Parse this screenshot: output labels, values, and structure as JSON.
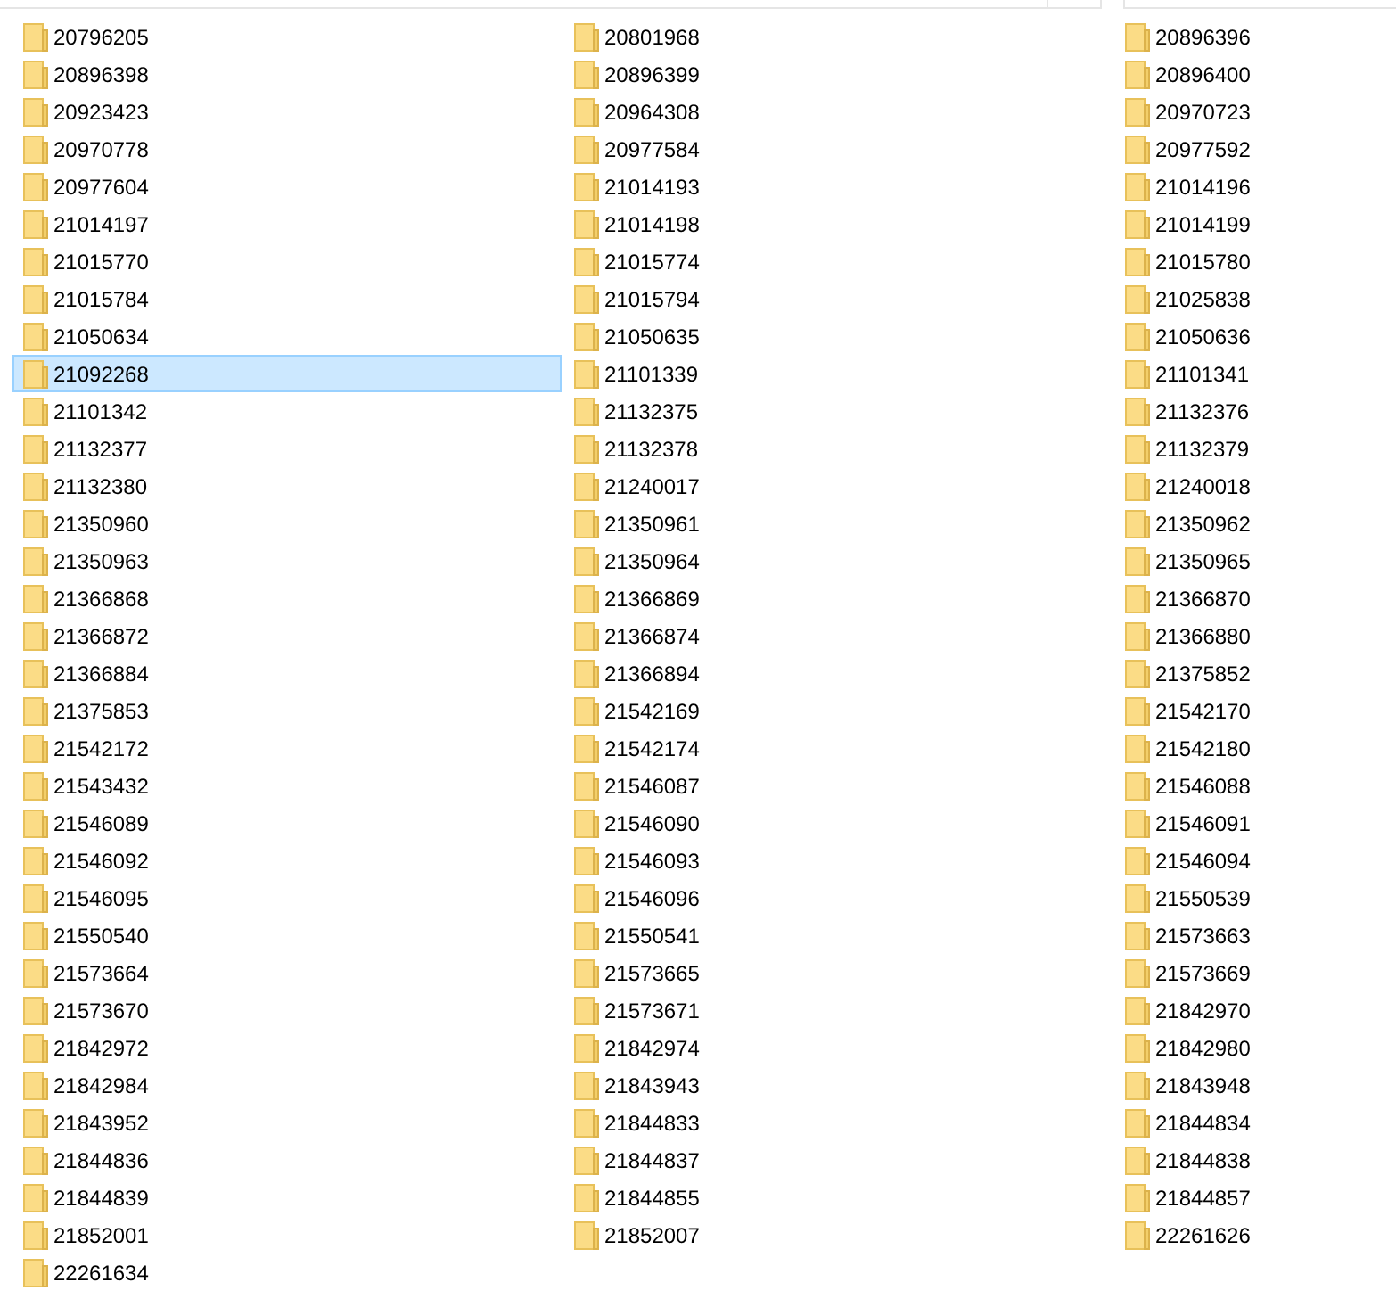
{
  "columns": [
    {
      "items": [
        {
          "name": "20796205",
          "selected": false
        },
        {
          "name": "20896398",
          "selected": false
        },
        {
          "name": "20923423",
          "selected": false
        },
        {
          "name": "20970778",
          "selected": false
        },
        {
          "name": "20977604",
          "selected": false
        },
        {
          "name": "21014197",
          "selected": false
        },
        {
          "name": "21015770",
          "selected": false
        },
        {
          "name": "21015784",
          "selected": false
        },
        {
          "name": "21050634",
          "selected": false
        },
        {
          "name": "21092268",
          "selected": true
        },
        {
          "name": "21101342",
          "selected": false
        },
        {
          "name": "21132377",
          "selected": false
        },
        {
          "name": "21132380",
          "selected": false
        },
        {
          "name": "21350960",
          "selected": false
        },
        {
          "name": "21350963",
          "selected": false
        },
        {
          "name": "21366868",
          "selected": false
        },
        {
          "name": "21366872",
          "selected": false
        },
        {
          "name": "21366884",
          "selected": false
        },
        {
          "name": "21375853",
          "selected": false
        },
        {
          "name": "21542172",
          "selected": false
        },
        {
          "name": "21543432",
          "selected": false
        },
        {
          "name": "21546089",
          "selected": false
        },
        {
          "name": "21546092",
          "selected": false
        },
        {
          "name": "21546095",
          "selected": false
        },
        {
          "name": "21550540",
          "selected": false
        },
        {
          "name": "21573664",
          "selected": false
        },
        {
          "name": "21573670",
          "selected": false
        },
        {
          "name": "21842972",
          "selected": false
        },
        {
          "name": "21842984",
          "selected": false
        },
        {
          "name": "21843952",
          "selected": false
        },
        {
          "name": "21844836",
          "selected": false
        },
        {
          "name": "21844839",
          "selected": false
        },
        {
          "name": "21852001",
          "selected": false
        },
        {
          "name": "22261634",
          "selected": false
        }
      ]
    },
    {
      "items": [
        {
          "name": "20801968",
          "selected": false
        },
        {
          "name": "20896399",
          "selected": false
        },
        {
          "name": "20964308",
          "selected": false
        },
        {
          "name": "20977584",
          "selected": false
        },
        {
          "name": "21014193",
          "selected": false
        },
        {
          "name": "21014198",
          "selected": false
        },
        {
          "name": "21015774",
          "selected": false
        },
        {
          "name": "21015794",
          "selected": false
        },
        {
          "name": "21050635",
          "selected": false
        },
        {
          "name": "21101339",
          "selected": false
        },
        {
          "name": "21132375",
          "selected": false
        },
        {
          "name": "21132378",
          "selected": false
        },
        {
          "name": "21240017",
          "selected": false
        },
        {
          "name": "21350961",
          "selected": false
        },
        {
          "name": "21350964",
          "selected": false
        },
        {
          "name": "21366869",
          "selected": false
        },
        {
          "name": "21366874",
          "selected": false
        },
        {
          "name": "21366894",
          "selected": false
        },
        {
          "name": "21542169",
          "selected": false
        },
        {
          "name": "21542174",
          "selected": false
        },
        {
          "name": "21546087",
          "selected": false
        },
        {
          "name": "21546090",
          "selected": false
        },
        {
          "name": "21546093",
          "selected": false
        },
        {
          "name": "21546096",
          "selected": false
        },
        {
          "name": "21550541",
          "selected": false
        },
        {
          "name": "21573665",
          "selected": false
        },
        {
          "name": "21573671",
          "selected": false
        },
        {
          "name": "21842974",
          "selected": false
        },
        {
          "name": "21843943",
          "selected": false
        },
        {
          "name": "21844833",
          "selected": false
        },
        {
          "name": "21844837",
          "selected": false
        },
        {
          "name": "21844855",
          "selected": false
        },
        {
          "name": "21852007",
          "selected": false
        }
      ]
    },
    {
      "items": [
        {
          "name": "20896396",
          "selected": false
        },
        {
          "name": "20896400",
          "selected": false
        },
        {
          "name": "20970723",
          "selected": false
        },
        {
          "name": "20977592",
          "selected": false
        },
        {
          "name": "21014196",
          "selected": false
        },
        {
          "name": "21014199",
          "selected": false
        },
        {
          "name": "21015780",
          "selected": false
        },
        {
          "name": "21025838",
          "selected": false
        },
        {
          "name": "21050636",
          "selected": false
        },
        {
          "name": "21101341",
          "selected": false
        },
        {
          "name": "21132376",
          "selected": false
        },
        {
          "name": "21132379",
          "selected": false
        },
        {
          "name": "21240018",
          "selected": false
        },
        {
          "name": "21350962",
          "selected": false
        },
        {
          "name": "21350965",
          "selected": false
        },
        {
          "name": "21366870",
          "selected": false
        },
        {
          "name": "21366880",
          "selected": false
        },
        {
          "name": "21375852",
          "selected": false
        },
        {
          "name": "21542170",
          "selected": false
        },
        {
          "name": "21542180",
          "selected": false
        },
        {
          "name": "21546088",
          "selected": false
        },
        {
          "name": "21546091",
          "selected": false
        },
        {
          "name": "21546094",
          "selected": false
        },
        {
          "name": "21550539",
          "selected": false
        },
        {
          "name": "21573663",
          "selected": false
        },
        {
          "name": "21573669",
          "selected": false
        },
        {
          "name": "21842970",
          "selected": false
        },
        {
          "name": "21842980",
          "selected": false
        },
        {
          "name": "21843948",
          "selected": false
        },
        {
          "name": "21844834",
          "selected": false
        },
        {
          "name": "21844838",
          "selected": false
        },
        {
          "name": "21844857",
          "selected": false
        },
        {
          "name": "22261626",
          "selected": false
        }
      ]
    }
  ]
}
